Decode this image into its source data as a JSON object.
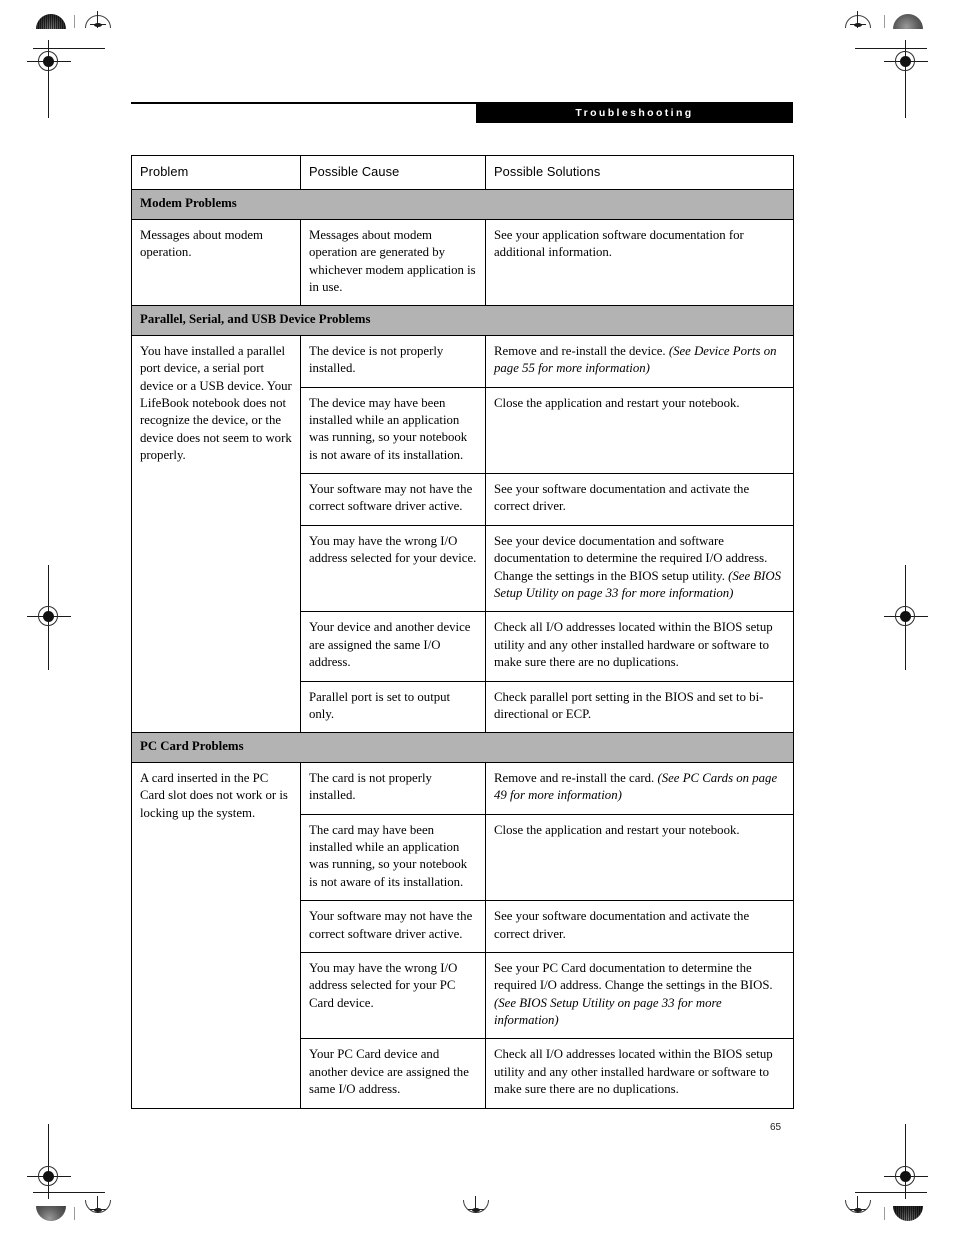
{
  "page": {
    "running_head": "Troubleshooting",
    "folio": "65"
  },
  "table": {
    "columns": [
      "Problem",
      "Possible Cause",
      "Possible Solutions"
    ],
    "sections": [
      {
        "title": "Modem Problems",
        "rows": [
          {
            "problem": "Messages about modem operation.",
            "cause": "Messages about modem operation are generated by whichever modem application is in use.",
            "solution": "See your application software documentation for additional information.",
            "solution_ref": ""
          }
        ]
      },
      {
        "title": "Parallel, Serial, and USB Device Problems",
        "rows": [
          {
            "problem": "You have installed a parallel port device, a serial port device or a USB device. Your LifeBook notebook does not recognize the device, or the device does not seem to work properly.",
            "cause": "The device is not properly installed.",
            "solution": "Remove and re-install the device.",
            "solution_ref": "(See Device Ports on page 55 for more information)"
          },
          {
            "problem": "",
            "cause": "The device may have been installed while an application was running, so your notebook is not aware of its installation.",
            "solution": "Close the application and restart your notebook.",
            "solution_ref": ""
          },
          {
            "problem": "",
            "cause": "Your software may not have the correct software driver active.",
            "solution": "See your software documentation and activate the correct driver.",
            "solution_ref": ""
          },
          {
            "problem": "",
            "cause": "You may have the wrong I/O address selected for your device.",
            "solution": "See your device documentation and software documentation to determine the required I/O address. Change the settings in the BIOS setup utility.",
            "solution_ref": "(See BIOS Setup Utility on page 33 for more information)"
          },
          {
            "problem": "",
            "cause": "Your device and another device are assigned the same I/O address.",
            "solution": "Check all I/O addresses located within the BIOS setup utility and any other installed hardware or software to make sure there are no duplications.",
            "solution_ref": ""
          },
          {
            "problem": "",
            "cause": "Parallel port is set to output only.",
            "solution": "Check parallel port setting in the BIOS and set to bi-directional or ECP.",
            "solution_ref": ""
          }
        ]
      },
      {
        "title": "PC Card Problems",
        "rows": [
          {
            "problem": "A card inserted in the PC Card slot does not work or is locking up the system.",
            "cause": "The card is not properly installed.",
            "solution": "Remove and re-install the card.",
            "solution_ref": "(See PC Cards on page 49 for more information)"
          },
          {
            "problem": "",
            "cause": "The card may have been installed while an application was running, so your notebook is not aware of its installation.",
            "solution": "Close the application and restart your notebook.",
            "solution_ref": ""
          },
          {
            "problem": "",
            "cause": "Your software may not have the correct software driver active.",
            "solution": "See your software documentation and activate the correct driver.",
            "solution_ref": ""
          },
          {
            "problem": "",
            "cause": "You may have the wrong I/O address selected for your PC Card device.",
            "solution": "See your PC Card documentation to determine the required I/O address. Change the settings in the BIOS.",
            "solution_ref": "(See BIOS Setup Utility on page 33 for more information)"
          },
          {
            "problem": "",
            "cause": "Your PC Card device and another device are assigned the same I/O address.",
            "solution": "Check all I/O addresses located within the BIOS setup utility and any other installed hardware or software to make sure there are no duplications.",
            "solution_ref": ""
          }
        ]
      }
    ]
  }
}
